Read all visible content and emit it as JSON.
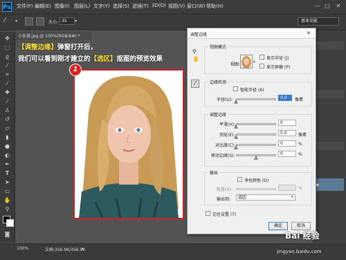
{
  "app": {
    "logo": "Ps"
  },
  "menu": [
    "文件(F)",
    "编辑(E)",
    "图像(I)",
    "图层(L)",
    "文字(Y)",
    "选择(S)",
    "滤镜(T)",
    "3D(D)",
    "视图(V)",
    "窗口(W)",
    "帮助(H)"
  ],
  "window_controls": [
    "—",
    "□",
    "✕"
  ],
  "options": {
    "size_label": "大小:",
    "size_value": "35",
    "workspace": "基本功能"
  },
  "document": {
    "tab_title": "小女孩.jpg @ 100%(RGB/8#) *",
    "zoom": "100%",
    "doc_info": "文档:356.9K/356.9K"
  },
  "caption": {
    "line1_bracket": "【调整边缘】",
    "line1_rest": "弹窗打开后，",
    "line2_a": "我们可以看到刚才建立的",
    "line2_b": "【选区】",
    "line2_c": "抠图的预览效果"
  },
  "badge": "1",
  "dialog": {
    "title": "调整边缘",
    "close": "✕",
    "view_mode": {
      "header": "视图模式",
      "view_label": "视图:",
      "show_radius": "显示半径 (J)",
      "show_original": "显示原稿 (P)"
    },
    "edge_detection": {
      "header": "边缘检测",
      "smart_radius": "智能半径 (A)",
      "radius_label": "半径(U):",
      "radius_value": "0.0",
      "radius_unit": "像素"
    },
    "adjust_edge": {
      "header": "调整边缘",
      "rows": [
        {
          "label": "平滑(H):",
          "value": "0",
          "unit": ""
        },
        {
          "label": "羽化(E):",
          "value": "0.0",
          "unit": "像素"
        },
        {
          "label": "对比度(C):",
          "value": "0",
          "unit": "%"
        },
        {
          "label": "移动边缘(S):",
          "value": "0",
          "unit": "%"
        }
      ]
    },
    "output": {
      "header": "输出",
      "decontaminate": "净化颜色 (D)",
      "amount_label": "数量(N):",
      "amount_unit": "%",
      "output_to_label": "输出到:",
      "output_to_value": "选区"
    },
    "remember": "记住设置 (T)",
    "ok": "确定",
    "cancel": "取消"
  },
  "watermark": {
    "logo": "Bai 经验",
    "url": "jingyan.baidu.com"
  }
}
